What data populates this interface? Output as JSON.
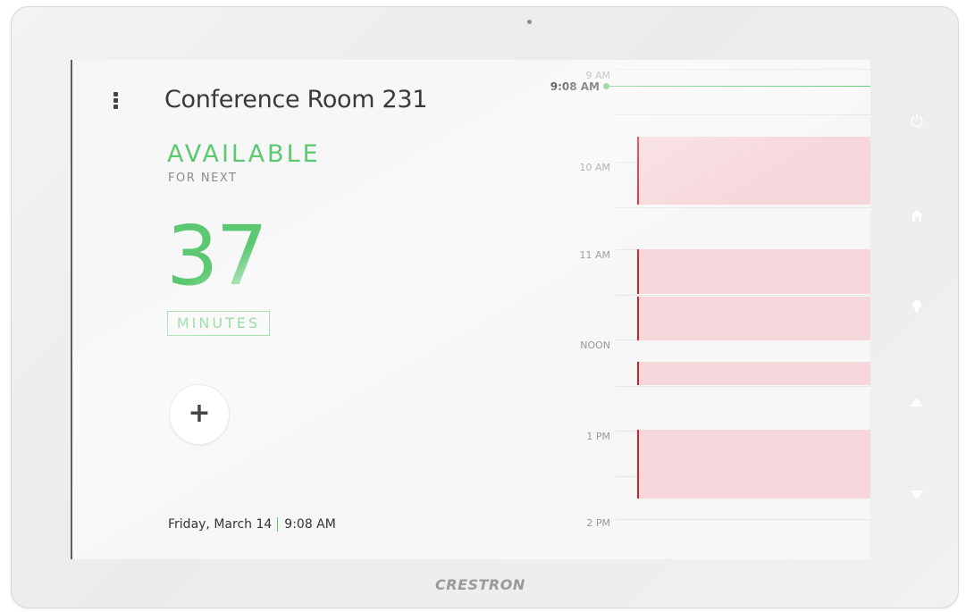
{
  "room": {
    "title": "Conference Room 231",
    "status": "AVAILABLE",
    "for_next": "FOR NEXT",
    "minutes": "37",
    "minutes_label": "MINUTES"
  },
  "footer": {
    "date": "Friday, March 14",
    "time": "9:08 AM"
  },
  "schedule": {
    "now_label": "9:08 AM",
    "hours": [
      "9 AM",
      "10 AM",
      "11 AM",
      "NOON",
      "1 PM",
      "2 PM"
    ],
    "meetings": [
      {
        "start": "10:00 AM",
        "end": "11:00 AM"
      },
      {
        "start": "11:00 AM",
        "end": "11:40 AM"
      },
      {
        "start": "11:40 AM",
        "end": "12:20 PM"
      },
      {
        "start": "12:20 PM",
        "end": "12:40 PM"
      },
      {
        "start": "1:00 PM",
        "end": "2:00 PM"
      }
    ]
  },
  "brand": "CRESTRON",
  "colors": {
    "accent": "#5dc872",
    "meeting_fill": "#f6d8dc",
    "meeting_edge": "#e02020"
  },
  "icons": {
    "menu": "menu-dots-icon",
    "add": "plus-icon",
    "power": "power-icon",
    "home": "home-icon",
    "light": "lightbulb-icon",
    "up": "arrow-up-icon",
    "down": "arrow-down-icon"
  }
}
